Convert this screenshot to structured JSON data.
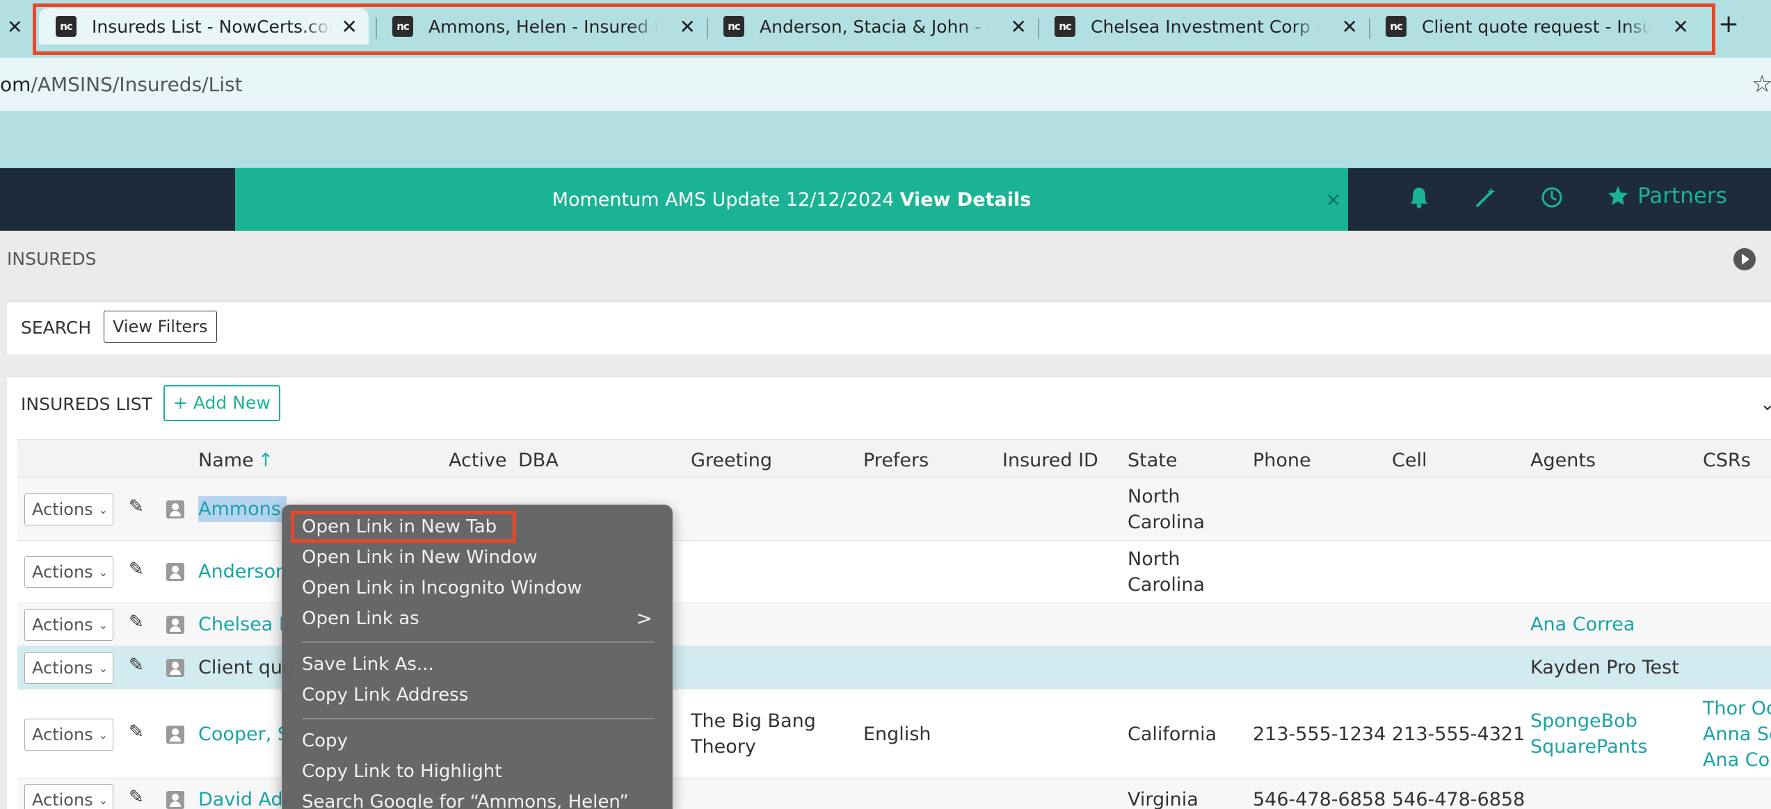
{
  "browser": {
    "tabs": [
      {
        "title": "Insureds List - NowCerts.com",
        "favicon": "nowcerts-logo",
        "active": true
      },
      {
        "title": "Ammons, Helen - Insured Details",
        "favicon": "nowcerts-logo",
        "active": false
      },
      {
        "title": "Anderson, Stacia & John - Insured",
        "favicon": "nowcerts-logo",
        "active": false
      },
      {
        "title": "Chelsea Investment Corp - Insured",
        "favicon": "nowcerts-logo",
        "active": false
      },
      {
        "title": "Client quote request - Insured",
        "favicon": "nowcerts-logo",
        "active": false
      }
    ],
    "favicon_text": "nc",
    "close_glyph": "✕",
    "new_tab_glyph": "+",
    "url_host": "om",
    "url_path": "/AMSINS/Insureds/List",
    "bookmark_icon": "star-outline-icon"
  },
  "header": {
    "banner_text": "Momentum AMS Update 12/12/2024",
    "banner_link": "View Details",
    "banner_close": "×",
    "icons": [
      "bell-icon",
      "magic-wand-icon",
      "clock-icon"
    ],
    "partners_label": "Partners",
    "accent_color": "#1ab394",
    "nav_bg": "#1d2b3a"
  },
  "page": {
    "title": "INSUREDS",
    "search_label": "SEARCH",
    "view_filters": "View Filters",
    "list_label": "INSUREDS LIST",
    "add_new": "+ Add New"
  },
  "table": {
    "columns": [
      "Name",
      "Active",
      "DBA",
      "Greeting",
      "Prefers",
      "Insured ID",
      "State",
      "Phone",
      "Cell",
      "Agents",
      "CSRs"
    ],
    "sort_column": "Name",
    "sort_direction": "ascending",
    "actions_label": "Actions",
    "rows": [
      {
        "name": "Ammons,",
        "state1": "North",
        "state2": "Carolina",
        "greeting1": "",
        "greeting2": "",
        "prefers": "",
        "phone": "",
        "cell": "",
        "agents1": "",
        "agents2": "",
        "csrs1": "",
        "csrs2": "",
        "csrs3": ""
      },
      {
        "name": "Anderson",
        "state1": "North",
        "state2": "Carolina",
        "greeting1": "",
        "greeting2": "",
        "prefers": "",
        "phone": "",
        "cell": "",
        "agents1": "",
        "agents2": "",
        "csrs1": "",
        "csrs2": "",
        "csrs3": ""
      },
      {
        "name": "Chelsea In",
        "state1": "",
        "state2": "",
        "greeting1": "",
        "greeting2": "",
        "prefers": "",
        "phone": "",
        "cell": "",
        "agents1": "Ana Correa",
        "agents2": "",
        "csrs1": "",
        "csrs2": "",
        "csrs3": ""
      },
      {
        "name": "Client quo",
        "state1": "",
        "state2": "",
        "greeting1": "",
        "greeting2": "",
        "prefers": "",
        "phone": "",
        "cell": "",
        "agents1": "Kayden Pro Test",
        "agents2": "",
        "csrs1": "",
        "csrs2": "",
        "csrs3": ""
      },
      {
        "name": "Cooper, S",
        "state1": "California",
        "state2": "",
        "greeting1": "The Big Bang",
        "greeting2": "Theory",
        "prefers": "English",
        "phone": "213-555-1234",
        "cell": "213-555-4321",
        "agents1": "SpongeBob",
        "agents2": "SquarePants",
        "csrs1": "Thor Od",
        "csrs2": "Anna Se",
        "csrs3": "Ana Cor"
      },
      {
        "name": "David Ada",
        "state1": "Virginia",
        "state2": "",
        "greeting1": "",
        "greeting2": "",
        "prefers": "",
        "phone": "546-478-6858",
        "cell": "546-478-6858",
        "agents1": "",
        "agents2": "",
        "csrs1": "",
        "csrs2": "",
        "csrs3": ""
      }
    ]
  },
  "context_menu": {
    "items": [
      "Open Link in New Tab",
      "Open Link in New Window",
      "Open Link in Incognito Window",
      "Open Link as",
      "Save Link As...",
      "Copy Link Address",
      "Copy",
      "Copy Link to Highlight",
      "Search Google for “Ammons, Helen”"
    ],
    "submenu_arrow": ">",
    "highlighted_item": "Open Link in New Tab",
    "annotation_color": "#e8472a"
  }
}
